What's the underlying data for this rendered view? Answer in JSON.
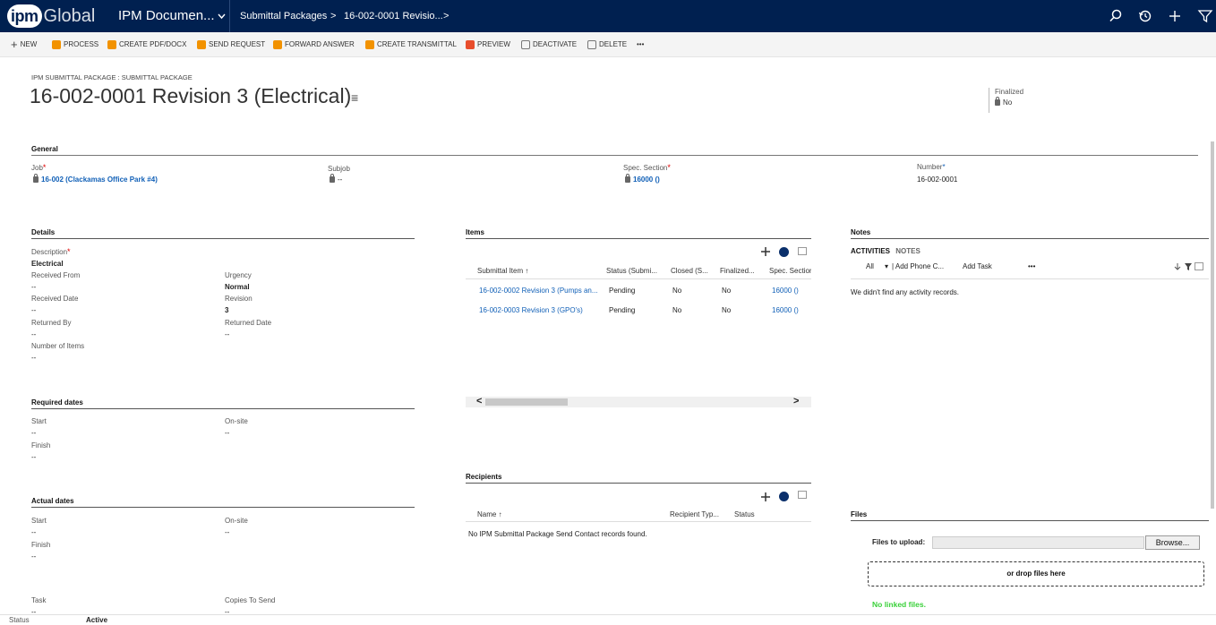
{
  "topbar": {
    "logo_mark": "ipm",
    "logo_text": "Global",
    "app_name": "IPM Documen...",
    "breadcrumb_entity": "Submittal Packages",
    "breadcrumb_sep1": ">",
    "breadcrumb_record": "16-002-0001 Revisio...",
    "breadcrumb_sep2": ">"
  },
  "commands": [
    {
      "label": "NEW",
      "icon": "plus-icon"
    },
    {
      "label": "PROCESS",
      "icon": "process-icon"
    },
    {
      "label": "CREATE PDF/DOCX",
      "icon": "pdf-icon"
    },
    {
      "label": "SEND REQUEST",
      "icon": "send-request-icon"
    },
    {
      "label": "FORWARD ANSWER",
      "icon": "forward-answer-icon"
    },
    {
      "label": "CREATE TRANSMITTAL",
      "icon": "transmittal-icon"
    },
    {
      "label": "PREVIEW",
      "icon": "preview-icon"
    },
    {
      "label": "DEACTIVATE",
      "icon": "deactivate-icon"
    },
    {
      "label": "DELETE",
      "icon": "trash-icon"
    },
    {
      "label": "•••",
      "icon": "more-icon"
    }
  ],
  "header": {
    "entity_type": "IPM SUBMITTAL PACKAGE : SUBMITTAL PACKAGE",
    "title": "16-002-0001 Revision 3 (Electrical)",
    "title_menu": "≡",
    "finalized_label": "Finalized",
    "finalized_value": "No"
  },
  "general": {
    "title": "General",
    "job_label": "Job",
    "job_value": "16-002 (Clackamas Office Park #4)",
    "subjob_label": "Subjob",
    "subjob_value": "--",
    "spec_label": "Spec. Section",
    "spec_value": "16000 ()",
    "number_label": "Number",
    "number_value": "16-002-0001",
    "required_mark": "*"
  },
  "details": {
    "title": "Details",
    "description_label": "Description",
    "description_value": "Electrical",
    "received_from_label": "Received From",
    "received_from_value": "--",
    "urgency_label": "Urgency",
    "urgency_value": "Normal",
    "received_date_label": "Received Date",
    "received_date_value": "--",
    "revision_label": "Revision",
    "revision_value": "3",
    "returned_by_label": "Returned By",
    "returned_by_value": "--",
    "returned_date_label": "Returned Date",
    "returned_date_value": "--",
    "number_of_items_label": "Number of Items",
    "number_of_items_value": "--"
  },
  "required_dates": {
    "title": "Required dates",
    "start_label": "Start",
    "start_value": "--",
    "onsite_label": "On-site",
    "onsite_value": "--",
    "finish_label": "Finish",
    "finish_value": "--"
  },
  "actual_dates": {
    "title": "Actual dates",
    "start_label": "Start",
    "start_value": "--",
    "onsite_label": "On-site",
    "onsite_value": "--",
    "finish_label": "Finish",
    "finish_value": "--",
    "task_label": "Task",
    "task_value": "--",
    "copies_label": "Copies To Send",
    "copies_value": "--"
  },
  "items": {
    "title": "Items",
    "columns": [
      "Submittal Item ↑",
      "Status (Submi...",
      "Closed (S...",
      "Finalized...",
      "Spec. Section"
    ],
    "rows": [
      {
        "item": "16-002-0002 Revision 3 (Pumps an...",
        "status": "Pending",
        "closed": "No",
        "finalized": "No",
        "spec": "16000 ()"
      },
      {
        "item": "16-002-0003 Revision 3 (GPO's)",
        "status": "Pending",
        "closed": "No",
        "finalized": "No",
        "spec": "16000 ()"
      }
    ],
    "scroll_left": "<",
    "scroll_right": ">"
  },
  "recipients": {
    "title": "Recipients",
    "columns": [
      "Name ↑",
      "Recipient Typ...",
      "Status"
    ],
    "empty": "No IPM Submittal Package Send Contact records found."
  },
  "notes": {
    "title": "Notes",
    "tab_activities": "ACTIVITIES",
    "tab_notes": "NOTES",
    "filter_all": "All",
    "filter_chevron": "▾",
    "add_phone": "| Add Phone C...",
    "add_task": "Add Task",
    "more": "•••",
    "empty": "We didn't find any activity records."
  },
  "files": {
    "title": "Files",
    "upload_label": "Files to upload:",
    "browse": "Browse...",
    "drop": "or drop files here",
    "no_files": "No linked files."
  },
  "status": {
    "label": "Status",
    "value": "Active"
  },
  "colors": {
    "topbar": "#002050",
    "link": "#1160b7",
    "success": "#3ad13a",
    "required": "#dd0000"
  }
}
